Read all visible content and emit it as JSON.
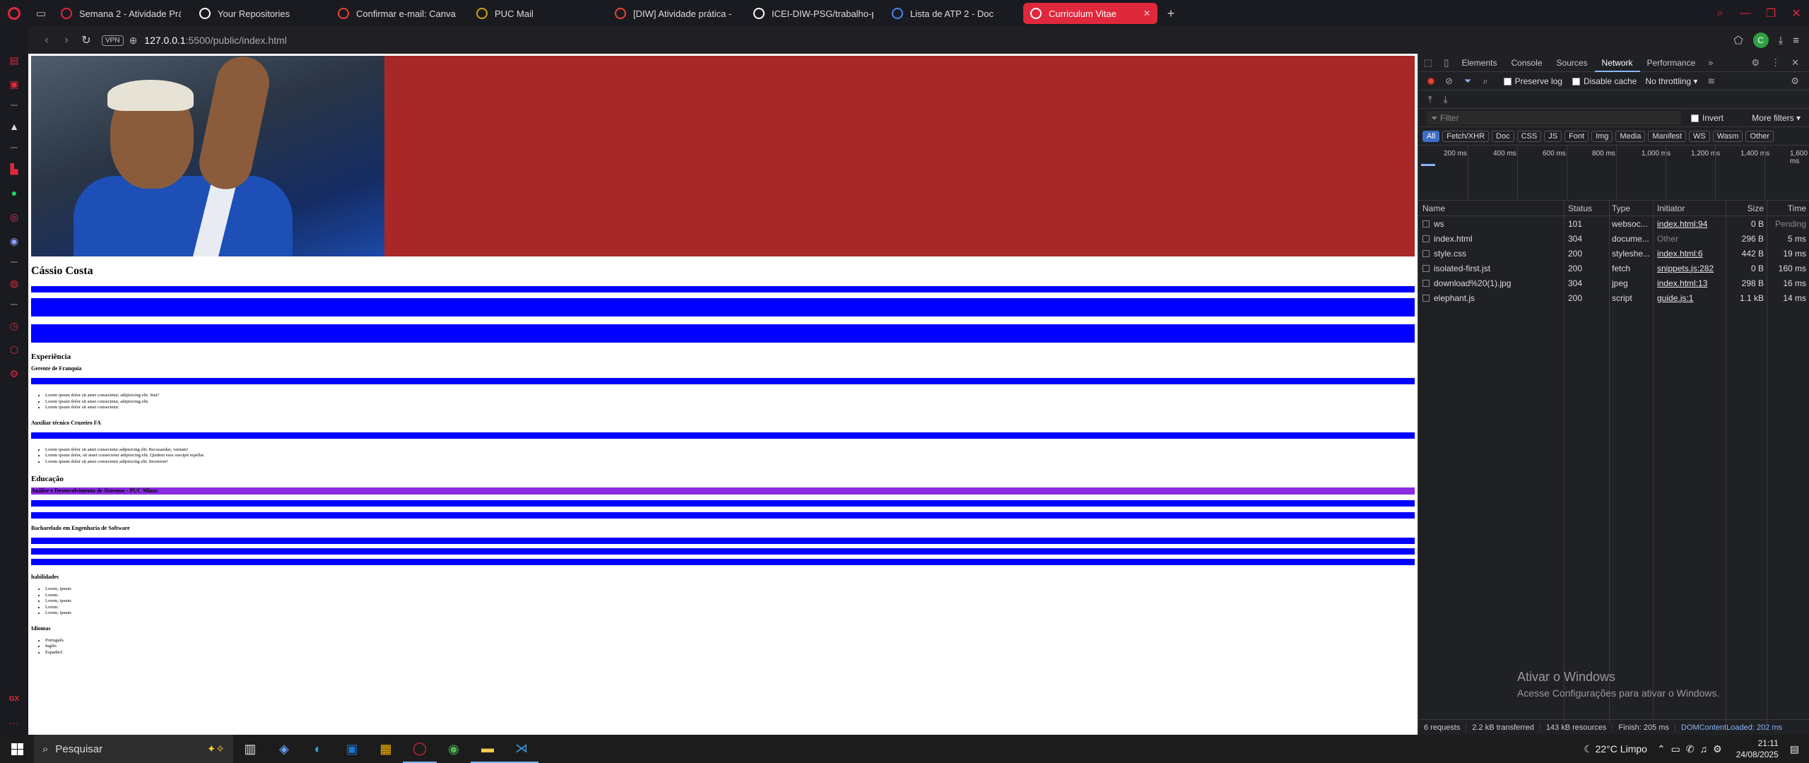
{
  "browser": {
    "tabs": [
      {
        "label": "Semana 2 - Atividade Prá",
        "icon": "canvas-icon",
        "color": "#e0283c"
      },
      {
        "label": "Your Repositories",
        "icon": "github-icon",
        "color": "#ffffff"
      },
      {
        "label": "Confirmar e-mail: Canva",
        "icon": "gmail-icon",
        "color": "#ea4335"
      },
      {
        "label": "PUC Mail",
        "icon": "puc-icon",
        "color": "#d4a017"
      },
      {
        "label": "[DIW] Atividade prática -",
        "icon": "gmail-icon",
        "color": "#ea4335"
      },
      {
        "label": "ICEI-DIW-PSG/trabalho-p",
        "icon": "github-icon",
        "color": "#ffffff"
      },
      {
        "label": "Lista de ATP 2 - Doc",
        "icon": "docs-icon",
        "color": "#4285f4"
      },
      {
        "label": "Curriculum Vitae",
        "icon": "globe-icon",
        "color": "#ffffff",
        "active": true
      }
    ],
    "url_host": "127.0.0.1",
    "url_rest": ":5500/public/index.html",
    "vpn_label": "VPN",
    "profile_initial": "C"
  },
  "page": {
    "name": "Cássio Costa",
    "experience_title": "Experiência",
    "job1_title": "Gerente de Franquia",
    "job1_items": [
      "Lorem ipsum dolor sit amet consectetur, adipisicing elit. Sint?",
      "Lorem ipsum dolor sit amet consectetur, adipisicing elit.",
      "Lorem ipsum dolor sit amet consectetur."
    ],
    "job2_title": "Auxiliar técnico Cruzeiro FA",
    "job2_items": [
      "Lorem ipsum dolor sit amet consectetur adipisicing elit. Recusandae, veniam!",
      "Lorem ipsum dolor, sit amet consectetur adipisicing elit. Quidem esse suscipit repellat.",
      "Lorem ipsum dolor sit amet consectetur adipisicing elit. Inventore!"
    ],
    "education_title": "Educação",
    "edu1_title": "Análise e Desenvolvimento de Sistemas - PUC Minas",
    "edu2_title": "Bacharelado em Engenharia de Software",
    "skills_title": "habilidades",
    "skills": [
      "Lorem, ipsum.",
      "Lorem.",
      "Lorem, ipsum.",
      "Lorem.",
      "Lorem, ipsum."
    ],
    "languages_title": "Idiomas",
    "languages": [
      "Português",
      "Inglês",
      "Espanhol"
    ]
  },
  "devtools": {
    "tabs": [
      "Elements",
      "Console",
      "Sources",
      "Network",
      "Performance"
    ],
    "selected_tab": "Network",
    "preserve_log": "Preserve log",
    "disable_cache": "Disable cache",
    "throttling": "No throttling",
    "filter_placeholder": "Filter",
    "invert": "Invert",
    "more_filters": "More filters",
    "type_filters": [
      "All",
      "Fetch/XHR",
      "Doc",
      "CSS",
      "JS",
      "Font",
      "Img",
      "Media",
      "Manifest",
      "WS",
      "Wasm",
      "Other"
    ],
    "timeline_ticks": [
      "200 ms",
      "400 ms",
      "600 ms",
      "800 ms",
      "1,000 ms",
      "1,200 ms",
      "1,400 ms",
      "1,600 ms"
    ],
    "columns": [
      "Name",
      "Status",
      "Type",
      "Initiator",
      "Size",
      "Time"
    ],
    "rows": [
      {
        "name": "ws",
        "status": "101",
        "type": "websoc...",
        "initiator": "index.html:94",
        "size": "0 B",
        "time": "Pending"
      },
      {
        "name": "index.html",
        "status": "304",
        "type": "docume...",
        "initiator": "Other",
        "size": "296 B",
        "time": "5 ms"
      },
      {
        "name": "style.css",
        "status": "200",
        "type": "styleshe...",
        "initiator": "index.html:6",
        "size": "442 B",
        "time": "19 ms"
      },
      {
        "name": "isolated-first.jst",
        "status": "200",
        "type": "fetch",
        "initiator": "snippets.js:282",
        "size": "0 B",
        "time": "160 ms"
      },
      {
        "name": "download%20(1).jpg",
        "status": "304",
        "type": "jpeg",
        "initiator": "index.html:13",
        "size": "298 B",
        "time": "16 ms"
      },
      {
        "name": "elephant.js",
        "status": "200",
        "type": "script",
        "initiator": "guide.js:1",
        "size": "1.1 kB",
        "time": "14 ms"
      }
    ],
    "status": {
      "requests": "6 requests",
      "transferred": "2.2 kB transferred",
      "resources": "143 kB resources",
      "finish": "Finish: 205 ms",
      "dcl": "DOMContentLoaded: 202 ms"
    },
    "watermark_title": "Ativar o Windows",
    "watermark_text": "Acesse Configurações para ativar o Windows."
  },
  "taskbar": {
    "search_label": "Pesquisar",
    "weather": "22°C  Limpo",
    "time": "21:11",
    "date": "24/08/2025"
  }
}
